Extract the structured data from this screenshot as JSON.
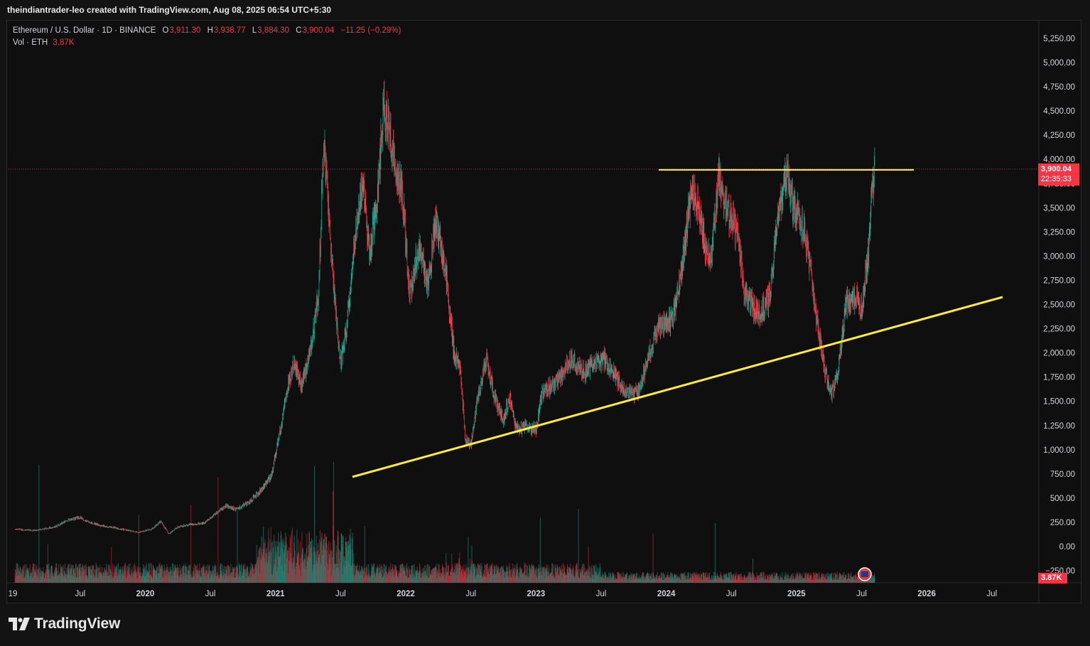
{
  "attribution": "theindiantrader-leo created with TradingView.com, Aug 08, 2025 06:54 UTC+5:30",
  "legend": {
    "symbol": "Ethereum / U.S. Dollar · 1D · BINANCE",
    "open_label": "O",
    "open": "3,911.30",
    "high_label": "H",
    "high": "3,938.77",
    "low_label": "L",
    "low": "3,884.30",
    "close_label": "C",
    "close": "3,900.04",
    "change": "−11.25 (−0.29%)",
    "vol_label": "Vol · ETH",
    "vol_value": "3.87K"
  },
  "price_tag": {
    "price": "3,900.04",
    "countdown": "22:35:33"
  },
  "volume_tag": "3.87K",
  "brand": "TradingView",
  "colors": {
    "up": "#22ab94",
    "down": "#f23645",
    "trendline": "#ffeb3b",
    "resistance": "#f7d774",
    "background": "#0f0f0f",
    "axis_text": "#d1d4dc"
  },
  "chart_data": {
    "type": "line",
    "title": "Ethereum / U.S. Dollar · 1D · BINANCE",
    "price_ticks": [
      "5,250.00",
      "5,000.00",
      "4,750.00",
      "4,500.00",
      "4,250.00",
      "4,000.00",
      "3,750.00",
      "3,500.00",
      "3,250.00",
      "3,000.00",
      "2,750.00",
      "2,500.00",
      "2,250.00",
      "2,000.00",
      "1,750.00",
      "1,500.00",
      "1,250.00",
      "1,000.00",
      "750.00",
      "500.00",
      "250.00",
      "0.00",
      "−250.00"
    ],
    "price_tick_values": [
      5250,
      5000,
      4750,
      4500,
      4250,
      4000,
      3750,
      3500,
      3250,
      3000,
      2750,
      2500,
      2250,
      2000,
      1750,
      1500,
      1250,
      1000,
      750,
      500,
      250,
      0,
      -250
    ],
    "ylim": [
      -250,
      5250
    ],
    "time_ticks": [
      {
        "label": "19",
        "t": 2019.62
      },
      {
        "label": "Jul",
        "t": 2019.5
      },
      {
        "label": "2020",
        "t": 2020.0
      },
      {
        "label": "Jul",
        "t": 2020.5
      },
      {
        "label": "2021",
        "t": 2021.0
      },
      {
        "label": "Jul",
        "t": 2021.5
      },
      {
        "label": "2022",
        "t": 2022.0
      },
      {
        "label": "Jul",
        "t": 2022.5
      },
      {
        "label": "2023",
        "t": 2023.0
      },
      {
        "label": "Jul",
        "t": 2023.5
      },
      {
        "label": "2024",
        "t": 2024.0
      },
      {
        "label": "Jul",
        "t": 2024.5
      },
      {
        "label": "2025",
        "t": 2025.0
      },
      {
        "label": "Jul",
        "t": 2025.5
      },
      {
        "label": "2026",
        "t": 2026.0
      },
      {
        "label": "Jul",
        "t": 2026.5
      }
    ],
    "xlim": [
      2018.95,
      2026.85
    ],
    "series": [
      {
        "values": [
          [
            2019.0,
            180
          ],
          [
            2019.15,
            165
          ],
          [
            2019.3,
            200
          ],
          [
            2019.42,
            280
          ],
          [
            2019.5,
            300
          ],
          [
            2019.55,
            260
          ],
          [
            2019.65,
            220
          ],
          [
            2019.8,
            185
          ],
          [
            2019.95,
            145
          ],
          [
            2020.05,
            180
          ],
          [
            2020.12,
            260
          ],
          [
            2020.18,
            130
          ],
          [
            2020.25,
            200
          ],
          [
            2020.35,
            230
          ],
          [
            2020.45,
            240
          ],
          [
            2020.55,
            350
          ],
          [
            2020.62,
            420
          ],
          [
            2020.7,
            380
          ],
          [
            2020.8,
            460
          ],
          [
            2020.9,
            600
          ],
          [
            2020.97,
            740
          ],
          [
            2021.05,
            1300
          ],
          [
            2021.1,
            1700
          ],
          [
            2021.15,
            1900
          ],
          [
            2021.2,
            1650
          ],
          [
            2021.28,
            2100
          ],
          [
            2021.33,
            2600
          ],
          [
            2021.37,
            4200
          ],
          [
            2021.4,
            3600
          ],
          [
            2021.45,
            2600
          ],
          [
            2021.5,
            1900
          ],
          [
            2021.55,
            2300
          ],
          [
            2021.6,
            3100
          ],
          [
            2021.67,
            3800
          ],
          [
            2021.72,
            3000
          ],
          [
            2021.78,
            3600
          ],
          [
            2021.83,
            4600
          ],
          [
            2021.87,
            4300
          ],
          [
            2021.92,
            3900
          ],
          [
            2021.97,
            3700
          ],
          [
            2022.03,
            2600
          ],
          [
            2022.1,
            3100
          ],
          [
            2022.17,
            2700
          ],
          [
            2022.23,
            3400
          ],
          [
            2022.3,
            2900
          ],
          [
            2022.37,
            2000
          ],
          [
            2022.42,
            1800
          ],
          [
            2022.46,
            1100
          ],
          [
            2022.5,
            1050
          ],
          [
            2022.55,
            1500
          ],
          [
            2022.62,
            1950
          ],
          [
            2022.68,
            1550
          ],
          [
            2022.75,
            1300
          ],
          [
            2022.8,
            1550
          ],
          [
            2022.85,
            1200
          ],
          [
            2022.93,
            1250
          ],
          [
            2023.0,
            1200
          ],
          [
            2023.05,
            1600
          ],
          [
            2023.12,
            1650
          ],
          [
            2023.2,
            1750
          ],
          [
            2023.27,
            1950
          ],
          [
            2023.32,
            1850
          ],
          [
            2023.38,
            1800
          ],
          [
            2023.45,
            1900
          ],
          [
            2023.52,
            1950
          ],
          [
            2023.58,
            1850
          ],
          [
            2023.65,
            1650
          ],
          [
            2023.72,
            1600
          ],
          [
            2023.78,
            1580
          ],
          [
            2023.85,
            1900
          ],
          [
            2023.92,
            2200
          ],
          [
            2023.97,
            2300
          ],
          [
            2024.05,
            2350
          ],
          [
            2024.12,
            2900
          ],
          [
            2024.2,
            3700
          ],
          [
            2024.25,
            3500
          ],
          [
            2024.3,
            3100
          ],
          [
            2024.35,
            3000
          ],
          [
            2024.4,
            3800
          ],
          [
            2024.45,
            3500
          ],
          [
            2024.5,
            3400
          ],
          [
            2024.55,
            3200
          ],
          [
            2024.6,
            2600
          ],
          [
            2024.65,
            2500
          ],
          [
            2024.72,
            2400
          ],
          [
            2024.8,
            2600
          ],
          [
            2024.85,
            3300
          ],
          [
            2024.93,
            3900
          ],
          [
            2024.97,
            3500
          ],
          [
            2025.02,
            3400
          ],
          [
            2025.07,
            3200
          ],
          [
            2025.12,
            2700
          ],
          [
            2025.17,
            2200
          ],
          [
            2025.22,
            1800
          ],
          [
            2025.27,
            1580
          ],
          [
            2025.32,
            1800
          ],
          [
            2025.38,
            2500
          ],
          [
            2025.45,
            2600
          ],
          [
            2025.5,
            2450
          ],
          [
            2025.55,
            3000
          ],
          [
            2025.58,
            3700
          ],
          [
            2025.6,
            3900
          ]
        ]
      }
    ]
  }
}
